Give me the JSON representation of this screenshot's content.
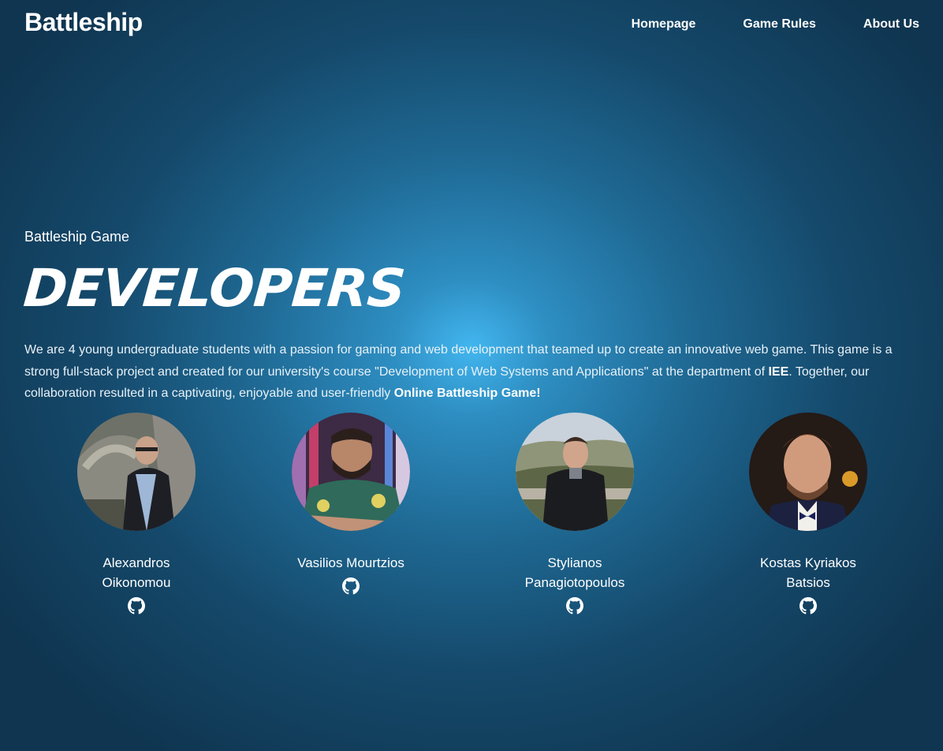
{
  "nav": {
    "brand": "Battleship",
    "links": [
      "Homepage",
      "Game Rules",
      "About Us"
    ]
  },
  "hero": {
    "subtitle": "Battleship Game",
    "headline": "DEVELOPERS",
    "intro_part1": "We are 4 young undergraduate students with a passion for gaming and web development that teamed up to create an innovative web game. This game is a strong full-stack project and created for our university's course \"Development of Web Systems and Applications\" at the department of ",
    "intro_bold1": "IEE",
    "intro_part2": ". Together, our collaboration resulted in a captivating, enjoyable and user-friendly ",
    "intro_bold2": "Online Battleship Game!"
  },
  "developers": [
    {
      "first": "Alexandros",
      "last": "Oikonomou",
      "icon": "github-icon"
    },
    {
      "first": "Vasilios Mourtzios",
      "last": "",
      "icon": "github-icon"
    },
    {
      "first": "Stylianos",
      "last": "Panagiotopoulos",
      "icon": "github-icon"
    },
    {
      "first": "Kostas Kyriakos",
      "last": "Batsios",
      "icon": "github-icon"
    }
  ],
  "colors": {
    "background_center": "#42b6ef",
    "background_edge": "#0f3550",
    "text": "#ffffff"
  }
}
